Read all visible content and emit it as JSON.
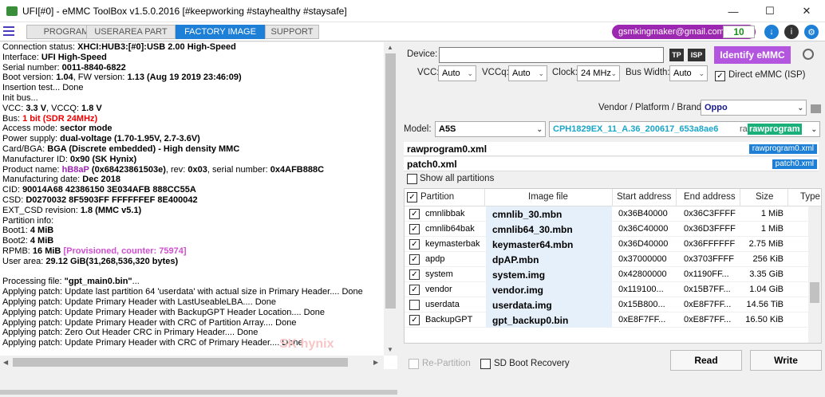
{
  "window": {
    "title": "UFI[#0] - eMMC ToolBox v1.5.0.2016 [#keepworking #stayhealthy #staysafe]",
    "minimize": "—",
    "maximize": "☐",
    "close": "✕"
  },
  "tabs": [
    "PROGRAM",
    "USERAREA PART",
    "FACTORY IMAGE",
    "SUPPORT"
  ],
  "header": {
    "email": "gsmkingmaker@gmail.com",
    "counter": "10"
  },
  "log": [
    [
      {
        "t": "Connection status: "
      },
      {
        "t": "XHCI:HUB3:[#0]:USB 2.00 High-Speed",
        "c": "b"
      }
    ],
    [
      {
        "t": "Interface: "
      },
      {
        "t": "UFI High-Speed",
        "c": "b"
      }
    ],
    [
      {
        "t": "Serial number: "
      },
      {
        "t": "0011-8840-6822",
        "c": "b"
      }
    ],
    [
      {
        "t": " Boot version: "
      },
      {
        "t": "1.04",
        "c": "b"
      },
      {
        "t": ", FW version: "
      },
      {
        "t": "1.13 (Aug 19 2019 23:46:09)",
        "c": "b"
      }
    ],
    [
      {
        "t": "Insertion test... Done"
      }
    ],
    [
      {
        "t": "Init bus..."
      }
    ],
    [
      {
        "t": "VCC: "
      },
      {
        "t": "3.3 V",
        "c": "b"
      },
      {
        "t": ", VCCQ: "
      },
      {
        "t": "1.8 V",
        "c": "b"
      }
    ],
    [
      {
        "t": "Bus: "
      },
      {
        "t": "1 bit (SDR 24MHz)",
        "c": "red"
      }
    ],
    [
      {
        "t": "Access mode: "
      },
      {
        "t": "sector mode",
        "c": "b"
      }
    ],
    [
      {
        "t": "Power supply: "
      },
      {
        "t": "dual-voltage (1.70-1.95V, 2.7-3.6V)",
        "c": "b"
      }
    ],
    [
      {
        "t": " Card/BGA: "
      },
      {
        "t": "BGA (Discrete embedded) - High density MMC",
        "c": "b"
      }
    ],
    [
      {
        "t": " Manufacturer ID: "
      },
      {
        "t": "0x90 (SK Hynix)",
        "c": "b"
      }
    ],
    [
      {
        "t": " Product name: "
      },
      {
        "t": "hB8aP",
        "c": "purple"
      },
      {
        "t": " "
      },
      {
        "t": "(0x68423861503e)",
        "c": "b"
      },
      {
        "t": ", rev: "
      },
      {
        "t": "0x03",
        "c": "b"
      },
      {
        "t": ", serial number: "
      },
      {
        "t": "0x4AFB888C",
        "c": "b"
      }
    ],
    [
      {
        "t": " Manufacturing date: "
      },
      {
        "t": "Dec 2018",
        "c": "b"
      }
    ],
    [
      {
        "t": "CID: "
      },
      {
        "t": "90014A68 42386150 3E034AFB 888CC55A",
        "c": "b"
      }
    ],
    [
      {
        "t": "CSD: "
      },
      {
        "t": "D0270032 8F5903FF FFFFFFEF 8E400042",
        "c": "b"
      }
    ],
    [
      {
        "t": "EXT_CSD revision: "
      },
      {
        "t": "1.8 (MMC v5.1)",
        "c": "b"
      }
    ],
    [
      {
        "t": "Partition info:"
      }
    ],
    [
      {
        "t": " Boot1: "
      },
      {
        "t": "4 MiB",
        "c": "b"
      }
    ],
    [
      {
        "t": " Boot2: "
      },
      {
        "t": "4 MiB",
        "c": "b"
      }
    ],
    [
      {
        "t": " RPMB: "
      },
      {
        "t": "16 MiB",
        "c": "b"
      },
      {
        "t": " "
      },
      {
        "t": "[Provisioned, counter: 75974]",
        "c": "pink"
      }
    ],
    [
      {
        "t": " User area: "
      },
      {
        "t": "29.12 GiB(31,268,536,320 bytes)",
        "c": "b"
      }
    ],
    [
      {
        "t": ""
      }
    ],
    [
      {
        "t": "Processing file: "
      },
      {
        "t": "\"gpt_main0.bin\"",
        "c": "b"
      },
      {
        "t": "..."
      }
    ],
    [
      {
        "t": "  Applying patch: Update last partition 64 'userdata' with actual size in Primary Header.... Done"
      }
    ],
    [
      {
        "t": "  Applying patch: Update Primary Header with LastUseableLBA.... Done"
      }
    ],
    [
      {
        "t": "  Applying patch: Update Primary Header with BackupGPT Header Location.... Done"
      }
    ],
    [
      {
        "t": "  Applying patch: Update Primary Header with CRC of Partition Array.... Done"
      }
    ],
    [
      {
        "t": "  Applying patch: Zero Out Header CRC in Primary Header.... Done"
      }
    ],
    [
      {
        "t": "  Applying patch: Update Primary Header with CRC of Primary Header.... Done"
      }
    ]
  ],
  "watermark": "SK hynix",
  "device": {
    "label": "Device:",
    "value": "",
    "tp": "TP",
    "isp": "ISP",
    "identify": "Identify eMMC",
    "vcc_label": "VCC:",
    "vcc": "Auto",
    "vccq_label": "VCCq:",
    "vccq": "Auto",
    "clock_label": "Clock:",
    "clock": "24 MHz",
    "bus_label": "Bus Width:",
    "bus": "Auto",
    "direct_label": "Direct eMMC (ISP)",
    "direct_checked": "✓",
    "vendor_label": "Vendor / Platform / Brand:",
    "vendor": "Oppo",
    "model_label": "Model:",
    "model": "A5S",
    "firmware": "CPH1829EX_11_A.36_200617_653a8ae6",
    "firmware_suffix": "ra",
    "firmware_tag": "rawprogram"
  },
  "files": [
    {
      "name": "rawprogram0.xml",
      "tag": "rawprogram0.xml"
    },
    {
      "name": "patch0.xml",
      "tag": "patch0.xml"
    }
  ],
  "show_all": "Show all partitions",
  "grid": {
    "headers": [
      "Partition",
      "Image file",
      "Start address",
      "End address",
      "Size",
      "Type"
    ],
    "header_checked": "✓",
    "rows": [
      {
        "check": "✓",
        "partition": "cmnlibbak",
        "image": "cmnlib_30.mbn",
        "start": "0x36B40000",
        "end": "0x36C3FFFF",
        "size": "1 MiB"
      },
      {
        "check": "✓",
        "partition": "cmnlib64bak",
        "image": "cmnlib64_30.mbn",
        "start": "0x36C40000",
        "end": "0x36D3FFFF",
        "size": "1 MiB"
      },
      {
        "check": "✓",
        "partition": "keymasterbak",
        "image": "keymaster64.mbn",
        "start": "0x36D40000",
        "end": "0x36FFFFFF",
        "size": "2.75 MiB"
      },
      {
        "check": "✓",
        "partition": "apdp",
        "image": "dpAP.mbn",
        "start": "0x37000000",
        "end": "0x3703FFFF",
        "size": "256 KiB"
      },
      {
        "check": "✓",
        "partition": "system",
        "image": "system.img",
        "start": "0x42800000",
        "end": "0x1190FF...",
        "size": "3.35 GiB"
      },
      {
        "check": "✓",
        "partition": "vendor",
        "image": "vendor.img",
        "start": "0x119100...",
        "end": "0x15B7FF...",
        "size": "1.04 GiB"
      },
      {
        "check": "",
        "partition": "userdata",
        "image": "userdata.img",
        "start": "0x15B800...",
        "end": "0xE8F7FF...",
        "size": "14.56 TiB"
      },
      {
        "check": "✓",
        "partition": "BackupGPT",
        "image": "gpt_backup0.bin",
        "start": "0xE8F7FF...",
        "end": "0xE8F7FF...",
        "size": "16.50 KiB"
      }
    ]
  },
  "options": {
    "repartition": "Re-Partition",
    "sd_boot": "SD Boot Recovery"
  },
  "buttons": {
    "read": "Read",
    "write": "Write"
  },
  "colors": {
    "accent": "#1e7fd6",
    "identify": "#b455e0",
    "email": "#9c27b0"
  }
}
